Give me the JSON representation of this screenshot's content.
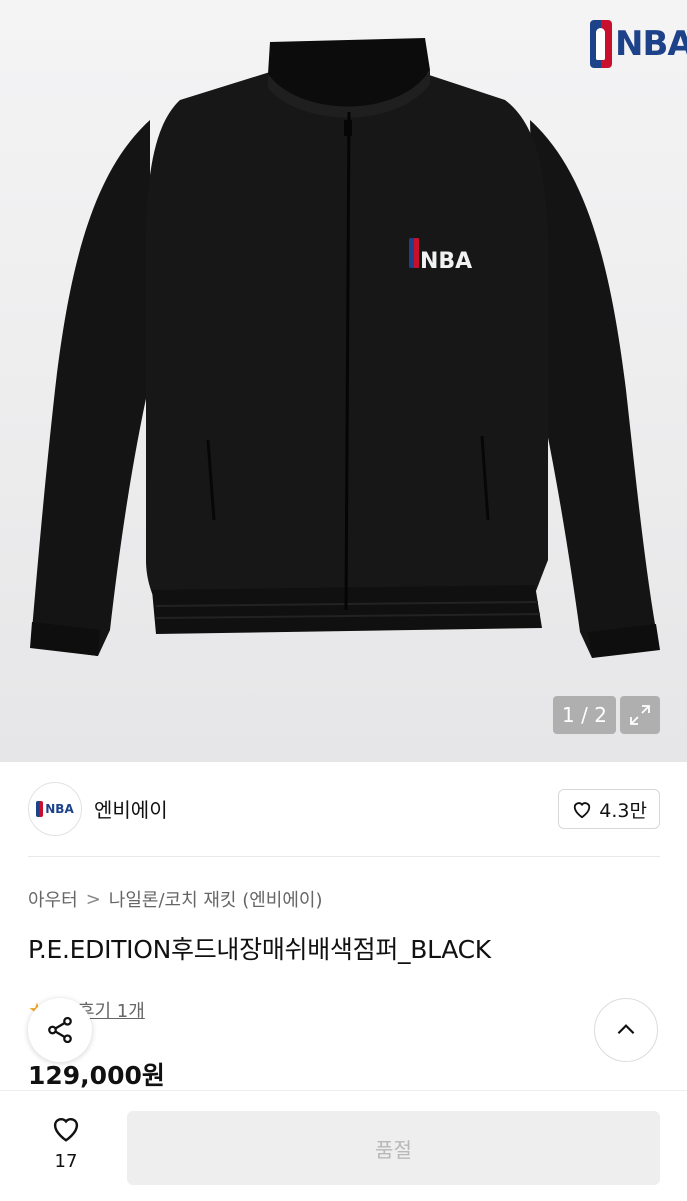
{
  "hero": {
    "image_alt": "",
    "brand_logo_text": "NBA",
    "jacket_logo_text": "NBA",
    "page_counter": "1 / 2"
  },
  "brand": {
    "avatar_text": "NBA",
    "name": "엔비에이",
    "likes": "4.3만"
  },
  "product": {
    "breadcrumb": [
      "아우터",
      "나일론/코치 재킷 (엔비에이)"
    ],
    "breadcrumb_separator": ">",
    "title": "P.E.EDITION후드내장매쉬배색점퍼_BLACK",
    "reviews_label": "후기 1개",
    "price": "129,000원"
  },
  "bottom_bar": {
    "wish_count": "17",
    "buy_button_label": "품절"
  },
  "colors": {
    "nba_blue": "#1d428a",
    "nba_red": "#c8102e",
    "disabled_button_bg": "#eeeeee",
    "disabled_button_text": "#b8b8b8"
  },
  "icons": [
    "nba-logo-icon",
    "expand-icon",
    "heart-icon",
    "share-icon",
    "chevron-up-icon",
    "star-icon"
  ]
}
